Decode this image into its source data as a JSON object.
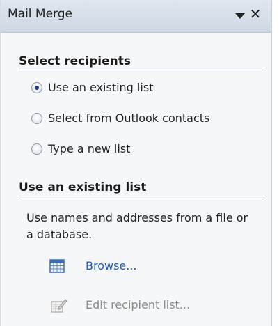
{
  "pane": {
    "title": "Mail Merge",
    "dropdown_icon": "chevron-down-icon",
    "close_icon": "close-icon",
    "close_glyph": "✕"
  },
  "select_recipients": {
    "heading": "Select recipients",
    "options": [
      {
        "label": "Use an existing list",
        "checked": true
      },
      {
        "label": "Select from Outlook contacts",
        "checked": false
      },
      {
        "label": "Type a new list",
        "checked": false
      }
    ]
  },
  "use_existing": {
    "heading": "Use an existing list",
    "description": "Use names and addresses from a file or a database.",
    "browse_label": "Browse...",
    "edit_label": "Edit recipient list...",
    "browse_icon": "table-icon",
    "edit_icon": "edit-list-icon"
  },
  "colors": {
    "link": "#1f58b7",
    "disabled": "#8c8c8c",
    "titlebar": "#d7dfea"
  }
}
